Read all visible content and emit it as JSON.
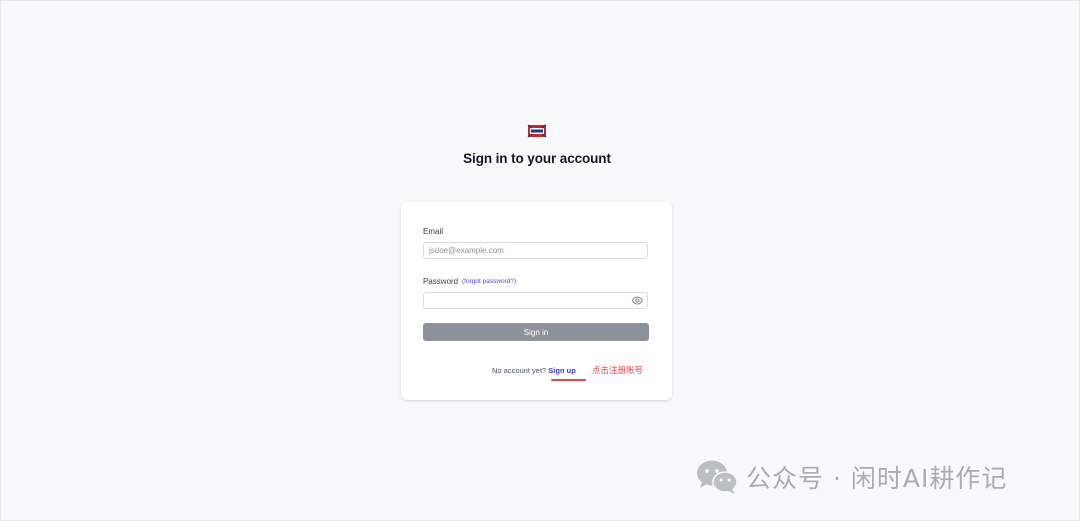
{
  "header": {
    "title": "Sign in to your account"
  },
  "form": {
    "email_label": "Email",
    "email_placeholder": "jsdoe@example.com",
    "email_value": "",
    "password_label": "Password",
    "forgot_link": "(forgot password?)",
    "password_value": "",
    "signin_button": "Sign in",
    "no_account_text": "No account yet?",
    "signup_link": "Sign up"
  },
  "annotation": {
    "text": "点击注册账号"
  },
  "watermark": {
    "text": "公众号 · 闲时AI耕作记"
  },
  "icons": {
    "logo": "app-logo",
    "password_toggle": "eye-icon",
    "watermark": "wechat-icon"
  },
  "colors": {
    "accent": "#4f46e5",
    "button": "#8d9199",
    "annotation": "#e5484d",
    "background": "#f8f9fb"
  }
}
